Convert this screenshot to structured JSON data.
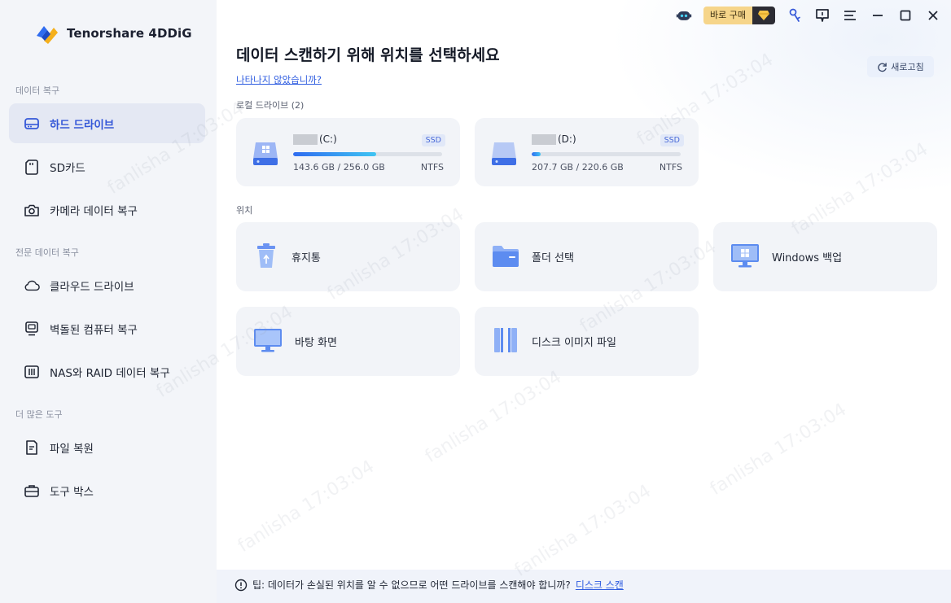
{
  "app": {
    "name": "Tenorshare 4DDiG"
  },
  "sidebar": {
    "sections": [
      {
        "label": "데이터 복구"
      },
      {
        "label": "전문 데이터 복구"
      },
      {
        "label": "더 많은 도구"
      }
    ],
    "items": [
      {
        "label": "하드 드라이브",
        "icon": "hard-drive-icon",
        "active": true
      },
      {
        "label": "SD카드",
        "icon": "sd-card-icon"
      },
      {
        "label": "카메라 데이터 복구",
        "icon": "camera-icon"
      },
      {
        "label": "클라우드 드라이브",
        "icon": "cloud-icon"
      },
      {
        "label": "벽돌된 컴퓨터 복구",
        "icon": "computer-icon"
      },
      {
        "label": "NAS와 RAID 데이터 복구",
        "icon": "nas-icon"
      },
      {
        "label": "파일 복원",
        "icon": "file-icon"
      },
      {
        "label": "도구 박스",
        "icon": "toolbox-icon"
      }
    ]
  },
  "topbar": {
    "buy_label": "바로 구매"
  },
  "main": {
    "title": "데이터 스캔하기 위해 위치를 선택하세요",
    "not_shown_link": "나타나지 않았습니까?",
    "refresh_label": "새로고침",
    "local_drives_label": "로컬 드라이브 (2)",
    "drives": [
      {
        "name": "(C:)",
        "badge": "SSD",
        "size": "143.6 GB / 256.0 GB",
        "fs": "NTFS",
        "usage": 0.56
      },
      {
        "name": "(D:)",
        "badge": "SSD",
        "size": "207.7 GB / 220.6 GB",
        "fs": "NTFS",
        "usage": 0.06
      }
    ],
    "locations_label": "위치",
    "locations": [
      {
        "label": "휴지통",
        "icon": "recycle-bin-icon"
      },
      {
        "label": "폴더 선택",
        "icon": "folder-icon"
      },
      {
        "label": "Windows 백업",
        "icon": "windows-backup-icon"
      },
      {
        "label": "바탕 화면",
        "icon": "desktop-icon"
      },
      {
        "label": "디스크 이미지 파일",
        "icon": "disk-image-icon"
      }
    ]
  },
  "tip": {
    "text": "팁: 데이터가 손실된 위치를 알 수 없으므로 어떤 드라이브를 스캔해야 합니까?",
    "link": "디스크 스캔"
  },
  "watermark": {
    "user": "fanlisha",
    "time": "17:03:04"
  },
  "colors": {
    "accent": "#3558d8",
    "link": "#2f5de0",
    "buy": "#f6d58a"
  }
}
